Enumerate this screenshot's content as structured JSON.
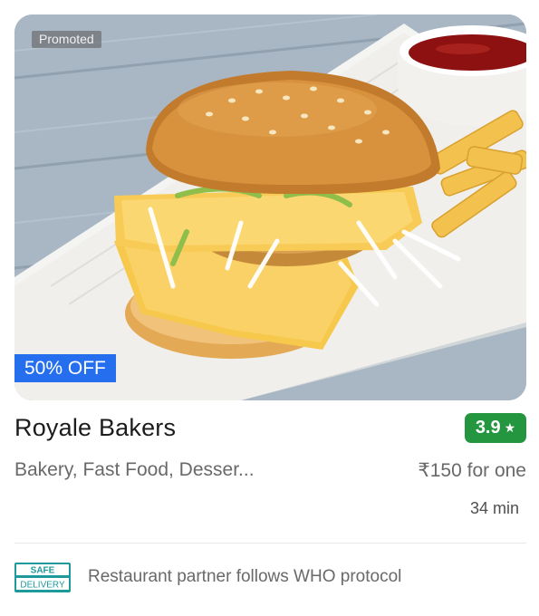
{
  "card": {
    "image_alt": "burger with fries and ketchup",
    "promoted_label": "Promoted",
    "offer_label": "50% OFF",
    "restaurant_name": "Royale Bakers",
    "rating": "3.9",
    "rating_star": "★",
    "cuisines": "Bakery, Fast Food, Desser...",
    "price_for_one": "₹150 for one",
    "delivery_time": "34 min",
    "safety_badge_line1": "SAFE",
    "safety_badge_line2": "DELIVERY",
    "safety_text": "Restaurant partner follows WHO protocol"
  },
  "colors": {
    "offer_blue": "#256fef",
    "rating_green": "#24963f",
    "badge_teal": "#1f9a9a",
    "text_muted": "#696969"
  },
  "icons": [
    "star-icon",
    "safe-delivery-icon"
  ]
}
